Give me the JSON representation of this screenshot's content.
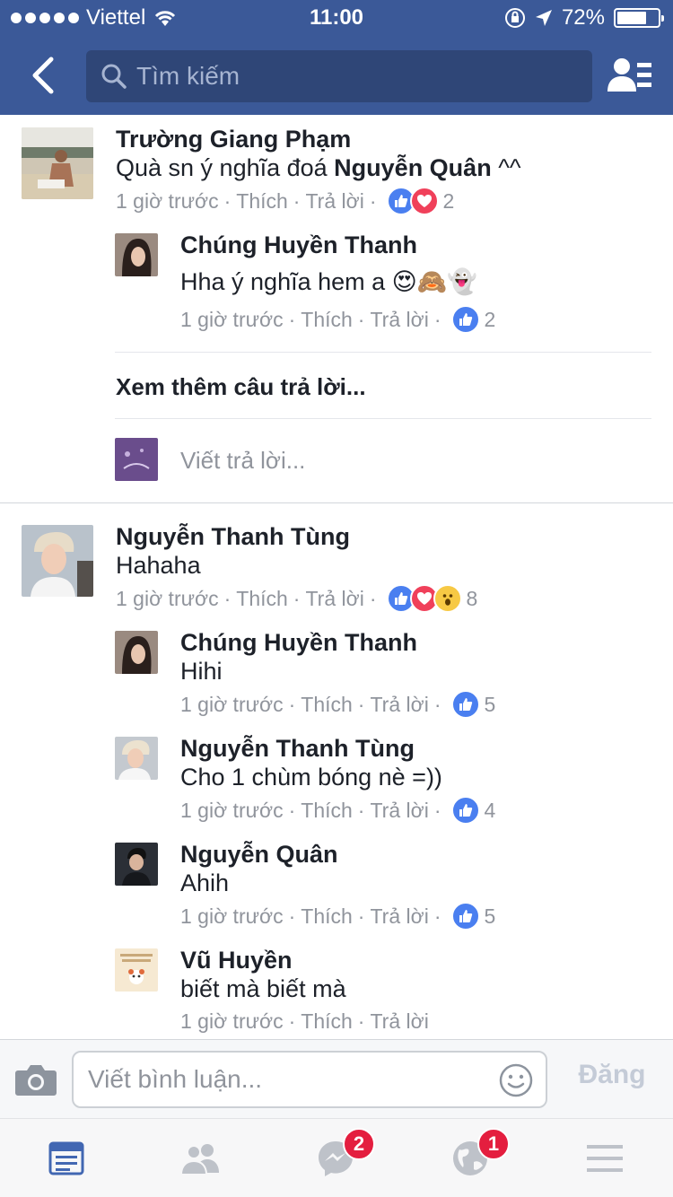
{
  "status_bar": {
    "carrier": "Viettel",
    "time": "11:00",
    "battery_percent": "72%",
    "battery_level": 0.72,
    "icons": [
      "signal-dots-icon",
      "wifi-icon",
      "orientation-lock-icon",
      "location-arrow-icon",
      "battery-icon"
    ]
  },
  "nav": {
    "search_placeholder": "Tìm kiếm",
    "icons": [
      "back-chevron-icon",
      "search-icon",
      "friends-list-icon"
    ],
    "brand_color": "#3b5998"
  },
  "threads": [
    {
      "author": "Trường Giang Phạm",
      "text_before": "Quà sn ý nghĩa đoá ",
      "text_mention": "Nguyễn Quân",
      "text_after": " ^^",
      "time": "1 giờ trước",
      "like": "Thích",
      "reply": "Trả lời",
      "reactions": [
        "like",
        "love"
      ],
      "reaction_count": "2",
      "replies": [
        {
          "author": "Chúng Huyền Thanh",
          "text": "Hha ý nghĩa hem a 😍🙈👻",
          "time": "1 giờ trước",
          "like": "Thích",
          "reply": "Trả lời",
          "reactions": [
            "like"
          ],
          "reaction_count": "2"
        }
      ],
      "more_replies": "Xem thêm câu trả lời...",
      "reply_placeholder": "Viết trả lời..."
    },
    {
      "author": "Nguyễn Thanh Tùng",
      "text": "Hahaha",
      "time": "1 giờ trước",
      "like": "Thích",
      "reply": "Trả lời",
      "reactions": [
        "like",
        "love",
        "wow"
      ],
      "reaction_count": "8",
      "replies": [
        {
          "author": "Chúng Huyền Thanh",
          "text": "Hihi",
          "time": "1 giờ trước",
          "like": "Thích",
          "reply": "Trả lời",
          "reaction_count": "5"
        },
        {
          "author": "Nguyễn Thanh Tùng",
          "text": "Cho 1 chùm bóng nè =))",
          "time": "1 giờ trước",
          "like": "Thích",
          "reply": "Trả lời",
          "reaction_count": "4"
        },
        {
          "author": "Nguyễn Quân",
          "text": "Ahih",
          "time": "1 giờ trước",
          "like": "Thích",
          "reply": "Trả lời",
          "reaction_count": "5"
        },
        {
          "author": "Vũ Huyền",
          "text": "biết mà biết mà",
          "time": "1 giờ trước",
          "like": "Thích",
          "reply": "Trả lời"
        }
      ]
    }
  ],
  "composer": {
    "placeholder": "Viết bình luận...",
    "post_label": "Đăng",
    "icons": [
      "camera-icon",
      "emoji-icon"
    ]
  },
  "tabbar": {
    "tabs": [
      {
        "name": "news-feed",
        "active": true
      },
      {
        "name": "friends"
      },
      {
        "name": "messenger",
        "badge": "2"
      },
      {
        "name": "notifications",
        "badge": "1"
      },
      {
        "name": "menu"
      }
    ],
    "active_color": "#4267b2",
    "inactive_color": "#bec2c9"
  }
}
